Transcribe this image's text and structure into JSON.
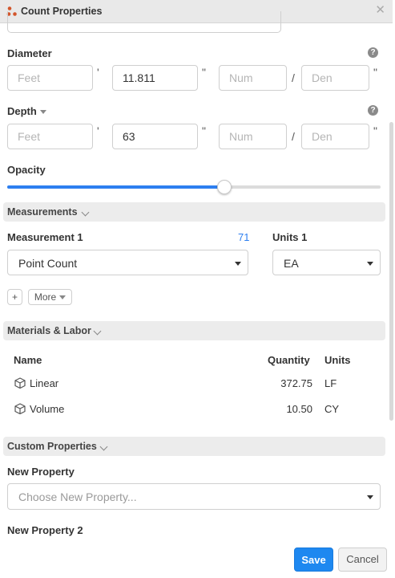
{
  "titlebar": {
    "title": "Count Properties"
  },
  "diameter": {
    "label": "Diameter",
    "help": "?",
    "feet_placeholder": "Feet",
    "feet_mark": "'",
    "inches_value": "11.811",
    "inches_mark": "\"",
    "num_placeholder": "Num",
    "slash": "/",
    "den_placeholder": "Den",
    "den_mark": "\""
  },
  "depth": {
    "label": "Depth",
    "help": "?",
    "feet_placeholder": "Feet",
    "feet_mark": "'",
    "inches_value": "63",
    "inches_mark": "\"",
    "num_placeholder": "Num",
    "slash": "/",
    "den_placeholder": "Den",
    "den_mark": "\""
  },
  "opacity": {
    "label": "Opacity",
    "value_fraction": 0.58
  },
  "measurements": {
    "section_title": "Measurements",
    "measurement_label": "Measurement 1",
    "measurement_count": "71",
    "measurement_value": "Point Count",
    "units_label": "Units 1",
    "units_value": "EA",
    "add_label": "+",
    "more_label": "More"
  },
  "materials": {
    "section_title": "Materials & Labor",
    "columns": {
      "name": "Name",
      "quantity": "Quantity",
      "units": "Units"
    },
    "rows": [
      {
        "name": "Linear",
        "quantity": "372.75",
        "units": "LF",
        "icon": "cube-icon"
      },
      {
        "name": "Volume",
        "quantity": "10.50",
        "units": "CY",
        "icon": "cube-icon"
      }
    ]
  },
  "custom": {
    "section_title": "Custom Properties",
    "new_property_label": "New Property",
    "new_property_placeholder": "Choose New Property...",
    "new_property_2_label": "New Property 2"
  },
  "footer": {
    "save_label": "Save",
    "cancel_label": "Cancel"
  },
  "colors": {
    "accent": "#1e88f0",
    "link": "#2d7ff0"
  }
}
